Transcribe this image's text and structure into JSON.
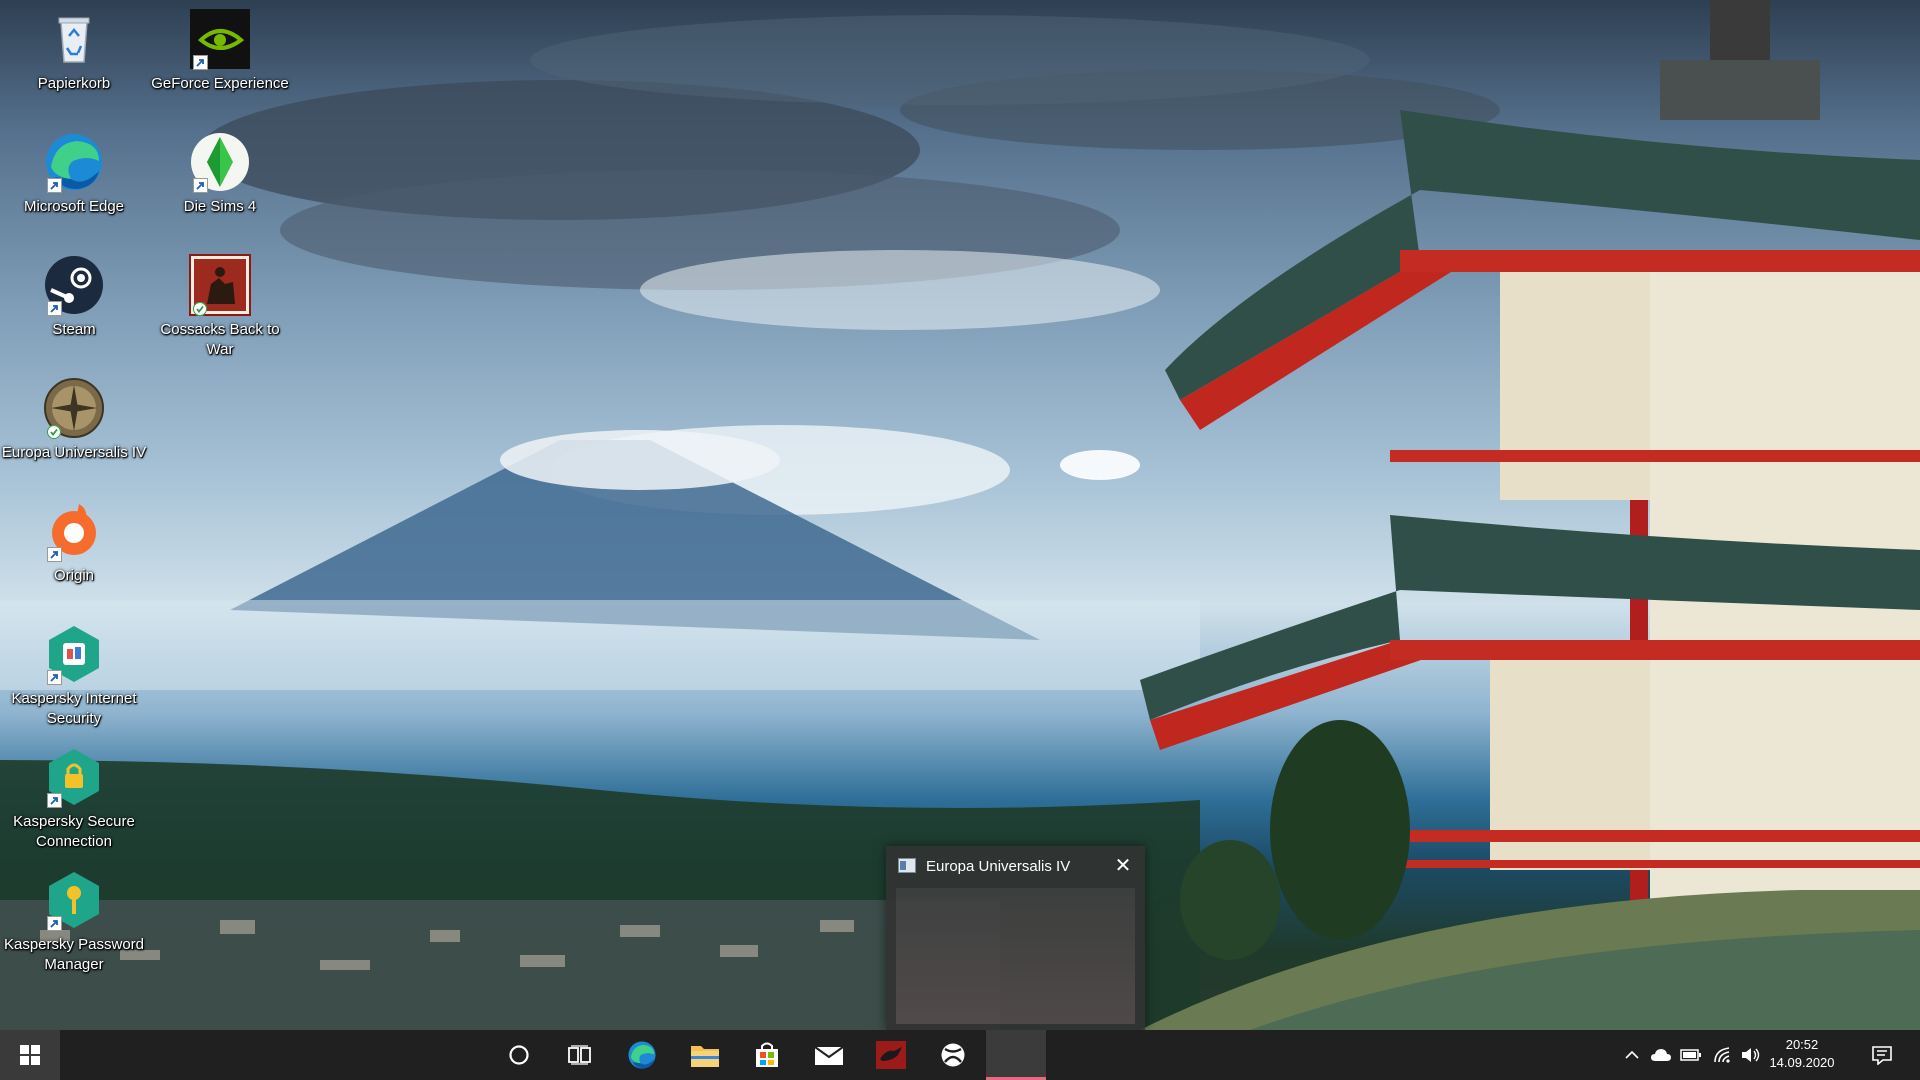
{
  "desktop": {
    "icons": [
      {
        "label": "Papierkorb",
        "icon": "recycle-bin-icon"
      },
      {
        "label": "GeForce Experience",
        "icon": "geforce-icon"
      },
      {
        "label": "Microsoft Edge",
        "icon": "edge-icon"
      },
      {
        "label": "Die Sims 4",
        "icon": "sims-plumbob-icon"
      },
      {
        "label": "Steam",
        "icon": "steam-icon"
      },
      {
        "label": "Cossacks Back to War",
        "icon": "cossacks-icon"
      },
      {
        "label": "Europa Universalis IV",
        "icon": "eu4-compass-icon"
      },
      {
        "label": "Origin",
        "icon": "origin-icon"
      },
      {
        "label": "Kaspersky Internet Security",
        "icon": "kaspersky-shield-icon"
      },
      {
        "label": "Kaspersky Secure Connection",
        "icon": "kaspersky-vpn-icon"
      },
      {
        "label": "Kaspersky Password Manager",
        "icon": "kaspersky-key-icon"
      }
    ]
  },
  "preview": {
    "title": "Europa Universalis IV",
    "close_glyph": "✕"
  },
  "taskbar": {
    "buttons": [
      "start-icon",
      "cortana-icon",
      "task-view-icon",
      "edge-icon",
      "file-explorer-icon",
      "store-icon",
      "mail-icon",
      "game-icon",
      "xbox-icon",
      "eu4-icon"
    ],
    "active_color": "#e86a80"
  },
  "tray": {
    "icons": [
      "chevron-up-icon",
      "onedrive-icon",
      "battery-icon",
      "wifi-icon",
      "volume-icon"
    ],
    "time": "20:52",
    "date": "14.09.2020"
  }
}
